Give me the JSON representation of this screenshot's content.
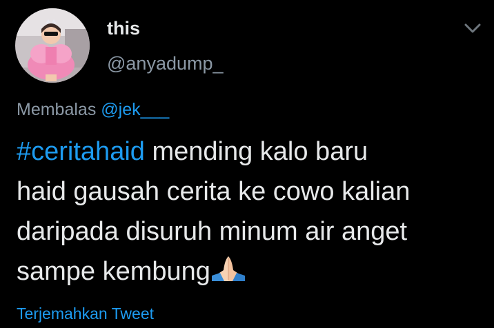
{
  "author": {
    "display_name": "this",
    "handle": "@anyadump_"
  },
  "reply": {
    "prefix": "Membalas",
    "mention": "@jek___"
  },
  "tweet": {
    "hashtag": "#ceritahaid",
    "line1_rest": " mending kalo baru",
    "line2": "haid gausah cerita ke cowo kalian",
    "line3": "daripada disuruh minum air anget",
    "line4": "sampe kembung",
    "emoji": "folded-hands-icon"
  },
  "actions": {
    "translate_label": "Terjemahkan Tweet"
  },
  "icons": {
    "menu": "chevron-down-icon",
    "avatar": "avatar"
  },
  "colors": {
    "background": "#000000",
    "text": "#e7e9ea",
    "secondary": "#8b98a5",
    "accent": "#1d9bf0"
  }
}
